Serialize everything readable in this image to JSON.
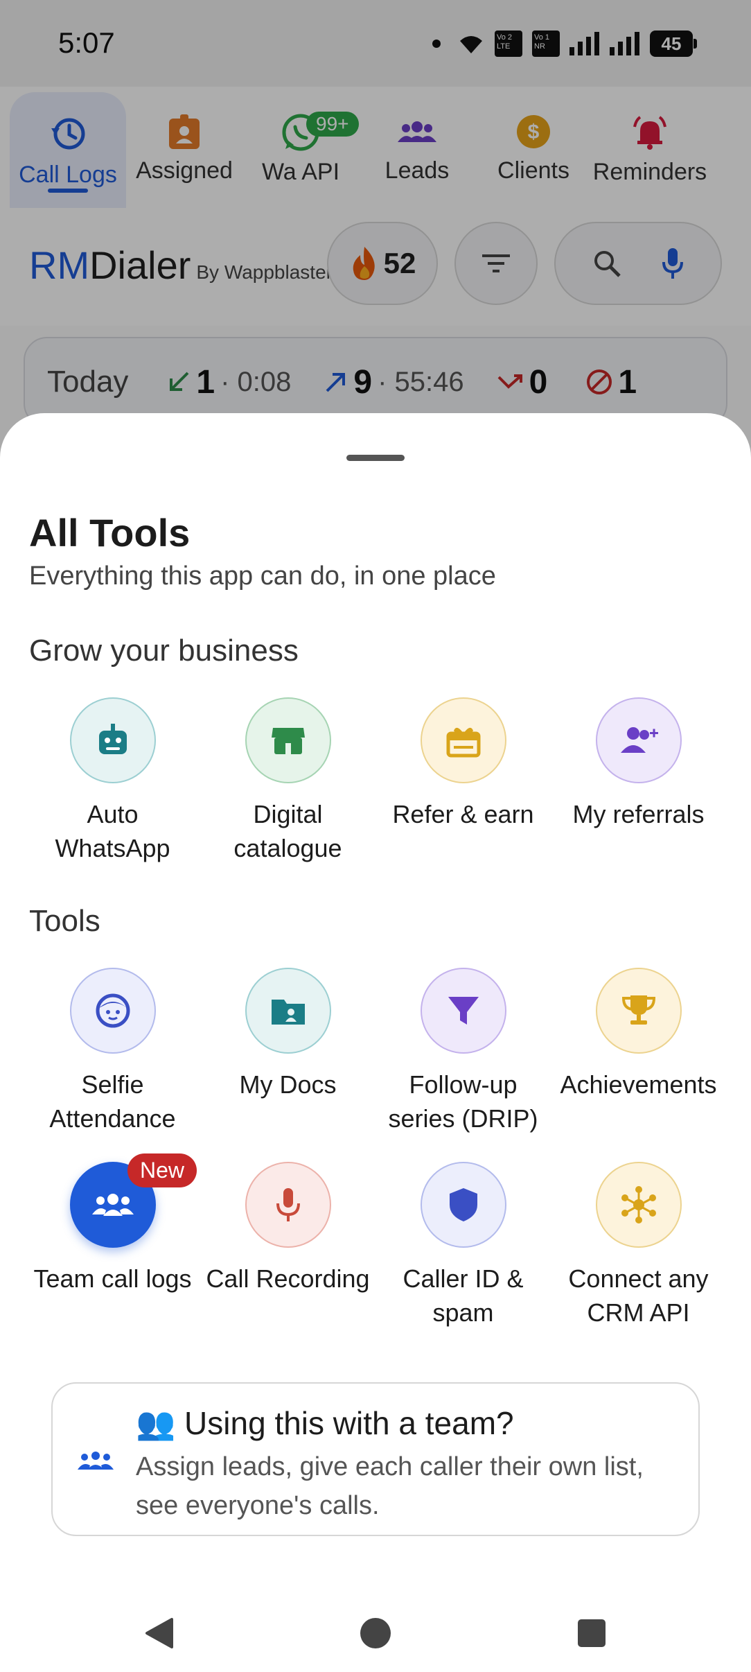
{
  "status_bar": {
    "time": "5:07",
    "volte1": "Vo 2 LTE",
    "volte2": "Vo 1 NR",
    "battery": "45"
  },
  "tabs": [
    {
      "label": "Call Logs",
      "icon": "history-icon",
      "active": true
    },
    {
      "label": "Assigned",
      "icon": "badge-icon"
    },
    {
      "label": "Wa API",
      "icon": "whatsapp-icon",
      "badge": "99+"
    },
    {
      "label": "Leads",
      "icon": "people-icon"
    },
    {
      "label": "Clients",
      "icon": "dollar-icon"
    },
    {
      "label": "Reminders",
      "icon": "bell-icon"
    }
  ],
  "header": {
    "brand_rm": "RM",
    "brand_dialer": "Dialer",
    "brand_by": "By Wappblaster",
    "streak": "52"
  },
  "today": {
    "label": "Today",
    "incoming_count": "1",
    "incoming_time": "· 0:08",
    "outgoing_count": "9",
    "outgoing_time": "· 55:46",
    "missed_count": "0",
    "blocked_count": "1"
  },
  "sheet": {
    "title": "All Tools",
    "subtitle": "Everything this app can do, in one place",
    "section_grow": "Grow your business",
    "section_tools": "Tools",
    "grow_tools": [
      {
        "label": "Auto WhatsApp",
        "icon": "robot-icon",
        "color": "#1b7d86"
      },
      {
        "label": "Digital catalogue",
        "icon": "store-icon",
        "color": "#2e8b4a"
      },
      {
        "label": "Refer & earn",
        "icon": "gift-icon",
        "color": "#d9a41a"
      },
      {
        "label": "My referrals",
        "icon": "person-add-icon",
        "color": "#6a3fc6"
      }
    ],
    "tools_row1": [
      {
        "label": "Selfie Attendance",
        "icon": "face-icon",
        "color": "#3a4fc4"
      },
      {
        "label": "My Docs",
        "icon": "folder-icon",
        "color": "#1b7d86"
      },
      {
        "label": "Follow-up series (DRIP)",
        "icon": "funnel-icon",
        "color": "#6a3fc6"
      },
      {
        "label": "Achievements",
        "icon": "trophy-icon",
        "color": "#d9a41a"
      }
    ],
    "tools_row2": [
      {
        "label": "Team call logs",
        "icon": "group-icon",
        "color": "#1f5bd8",
        "badge": "New"
      },
      {
        "label": "Call Recording",
        "icon": "mic-icon",
        "color": "#c84a3a"
      },
      {
        "label": "Caller ID & spam",
        "icon": "shield-icon",
        "color": "#3a4fc4"
      },
      {
        "label": "Connect any CRM API",
        "icon": "hub-icon",
        "color": "#d9a41a"
      }
    ],
    "team_card": {
      "title": "👥 Using this with a team?",
      "body": "Assign leads, give each caller their own list, see everyone's calls."
    }
  }
}
